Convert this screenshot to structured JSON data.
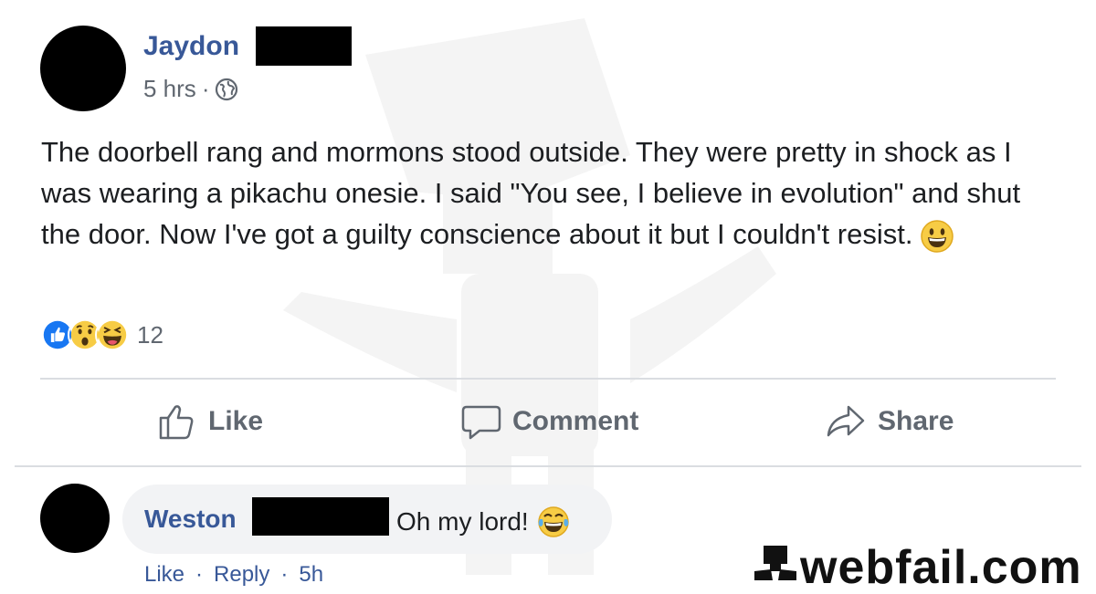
{
  "post": {
    "author_name": "Jaydon",
    "time": "5 hrs",
    "separator": "·",
    "privacy_icon": "globe-icon",
    "text": "The doorbell rang and mormons stood outside. They were pretty in shock as I was wearing a pikachu onesie. I said \"You see, I believe in evolution\" and shut the door. Now I've got a guilty conscience about it but I couldn't resist.",
    "text_emoji": "grinning-face-emoji",
    "reactions": {
      "icons": [
        "like-reaction",
        "wow-reaction",
        "haha-reaction"
      ],
      "count": "12"
    }
  },
  "actions": {
    "like_label": "Like",
    "comment_label": "Comment",
    "share_label": "Share"
  },
  "comment": {
    "author_name": "Weston",
    "text": "Oh my lord!",
    "emoji": "tears-of-joy-emoji",
    "like_label": "Like",
    "reply_label": "Reply",
    "separator": "·",
    "time": "5h"
  },
  "watermark": {
    "brand": "webfail.com"
  },
  "colors": {
    "link_blue": "#385898",
    "muted": "#606770",
    "bubble": "#f2f3f5",
    "divider": "#dadde1",
    "like_blue": "#1877f2",
    "emoji_yellow": "#f7cc45"
  }
}
